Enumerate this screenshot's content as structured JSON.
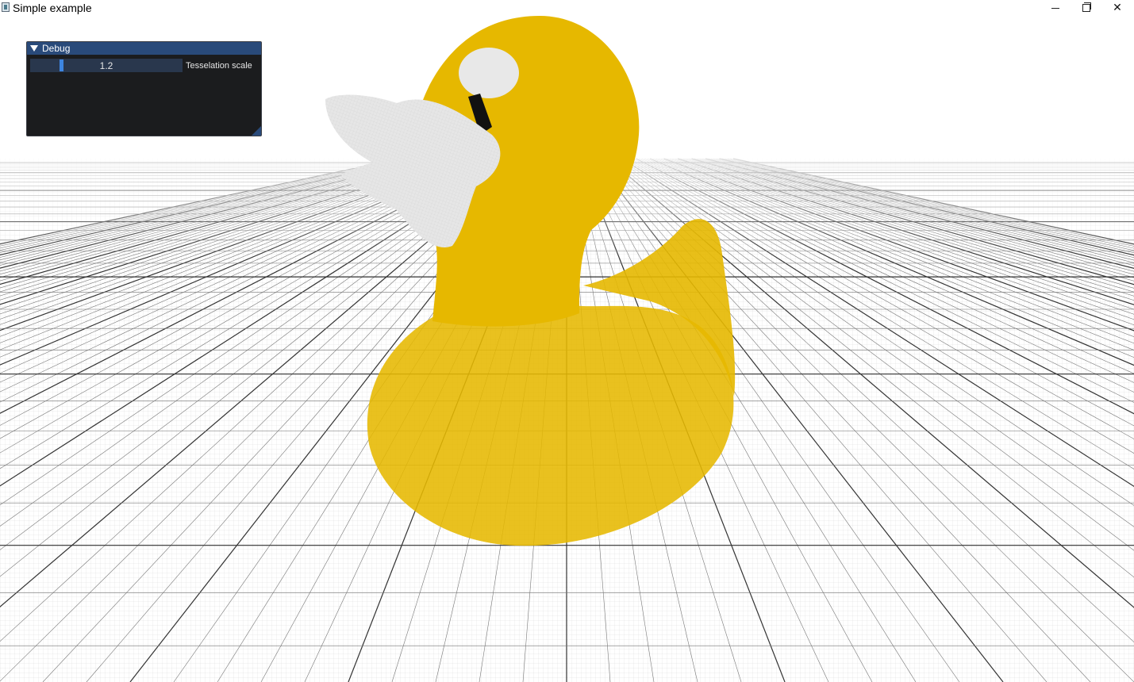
{
  "window": {
    "title": "Simple example",
    "controls": [
      "minimize",
      "maximize",
      "close"
    ]
  },
  "debug_panel": {
    "title": "Debug",
    "slider": {
      "value": "1.2",
      "label": "Tesselation scale",
      "fraction": 0.2
    }
  },
  "colors": {
    "duck_yellow": "#e6b800",
    "beak_white": "#e8e8e8",
    "panel_header": "#294a7a",
    "panel_bg": "#1b1c1e",
    "slider_grab": "#3d85e0"
  },
  "icons": [
    "app-icon",
    "collapse-triangle-icon",
    "minimize-icon",
    "maximize-icon",
    "close-icon",
    "resize-grip-icon"
  ]
}
